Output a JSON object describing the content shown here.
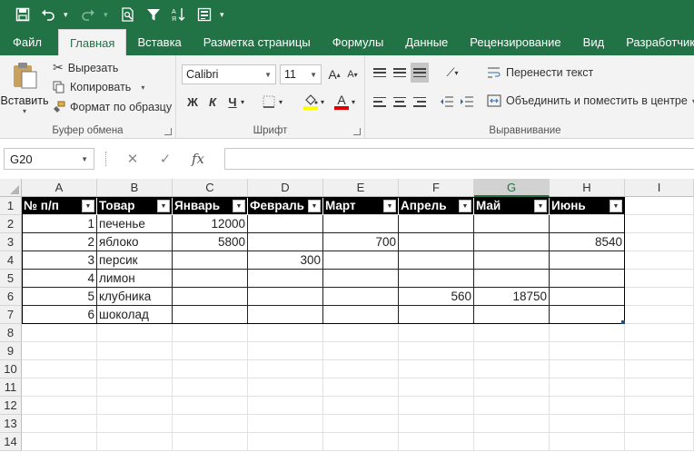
{
  "qat": {
    "icons": [
      "save-icon",
      "undo-icon",
      "redo-icon",
      "print-preview-icon",
      "filter-icon",
      "sort-icon",
      "form-icon"
    ]
  },
  "tabs": [
    "Файл",
    "Главная",
    "Вставка",
    "Разметка страницы",
    "Формулы",
    "Данные",
    "Рецензирование",
    "Вид",
    "Разработчик"
  ],
  "active_tab": "Главная",
  "clipboard": {
    "paste": "Вставить",
    "cut": "Вырезать",
    "copy": "Копировать",
    "format_painter": "Формат по образцу",
    "label": "Буфер обмена"
  },
  "font": {
    "name": "Calibri",
    "size": "11",
    "grow": "A",
    "shrink": "A",
    "bold": "Ж",
    "italic": "К",
    "underline": "Ч",
    "font_color_letter": "A",
    "label": "Шрифт"
  },
  "alignment": {
    "wrap_text": "Перенести текст",
    "merge_center": "Объединить и поместить в центре",
    "label": "Выравнивание"
  },
  "formula_bar": {
    "name_box": "G20",
    "cancel": "✕",
    "enter": "✓",
    "fx": "fx",
    "value": ""
  },
  "sheet": {
    "columns": [
      "A",
      "B",
      "C",
      "D",
      "E",
      "F",
      "G",
      "H",
      "I"
    ],
    "selected_column": "G",
    "rows": [
      "1",
      "2",
      "3",
      "4",
      "5",
      "6",
      "7",
      "8",
      "9",
      "10",
      "11",
      "12",
      "13",
      "14"
    ],
    "table_headers": [
      "№ п/п",
      "Товар",
      "Январь",
      "Февраль",
      "Март",
      "Апрель",
      "Май",
      "Июнь"
    ],
    "table_rows": [
      [
        "1",
        "печенье",
        "12000",
        "",
        "",
        "",
        "",
        ""
      ],
      [
        "2",
        "яблоко",
        "5800",
        "",
        "700",
        "",
        "",
        "8540"
      ],
      [
        "3",
        "персик",
        "",
        "300",
        "",
        "",
        "",
        ""
      ],
      [
        "4",
        "лимон",
        "",
        "",
        "",
        "",
        "",
        ""
      ],
      [
        "5",
        "клубника",
        "",
        "",
        "",
        "560",
        "18750",
        ""
      ],
      [
        "6",
        "шоколад",
        "",
        "",
        "",
        "",
        "",
        ""
      ]
    ]
  },
  "colors": {
    "excel_green": "#217346",
    "ribbon_bg": "#f3f3f3",
    "header_fill": "#000000"
  }
}
